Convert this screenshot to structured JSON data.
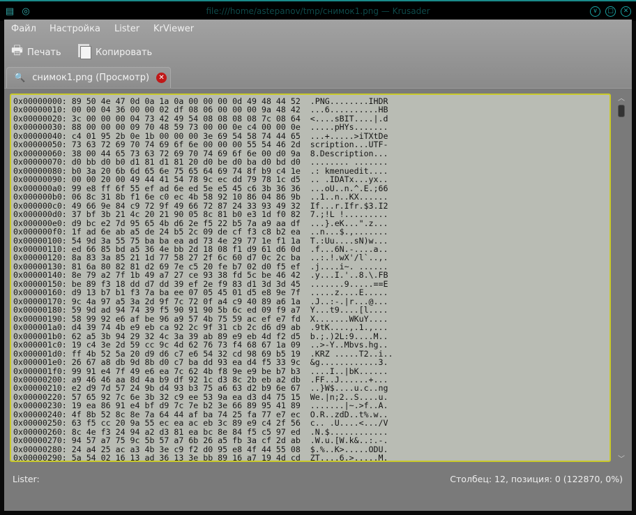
{
  "window": {
    "title": "file:///home/astepanov/tmp/снимок1.png — Krusader"
  },
  "menu": [
    "Файл",
    "Настройка",
    "Lister",
    "KrViewer"
  ],
  "toolbar": {
    "print": "Печать",
    "copy": "Копировать"
  },
  "tab": {
    "label": "снимок1.png (Просмотр)"
  },
  "status": {
    "left": "Lister:",
    "right": "Столбец:  12, позиция: 0 (122870, 0%)"
  },
  "colors": {
    "viewer_bg": "#b9bcb4",
    "viewer_border": "#c9c92a",
    "accent": "#1aa3a3"
  },
  "rows": [
    [
      "0x00000000:",
      "89 50 4e 47 0d 0a 1a 0a 00 00 00 0d 49 48 44 52",
      ".PNG........IHDR"
    ],
    [
      "0x00000010:",
      "00 00 04 36 00 00 02 df 08 06 00 00 00 9a 48 42",
      "...6..........HB"
    ],
    [
      "0x00000020:",
      "3c 00 00 00 04 73 42 49 54 08 08 08 08 7c 08 64",
      "<....sBIT....|.d"
    ],
    [
      "0x00000030:",
      "88 00 00 00 09 70 48 59 73 00 00 0e c4 00 00 0e",
      ".....pHYs......."
    ],
    [
      "0x00000040:",
      "c4 01 95 2b 0e 1b 00 00 00 3e 69 54 58 74 44 65",
      "...+.....>iTXtDe"
    ],
    [
      "0x00000050:",
      "73 63 72 69 70 74 69 6f 6e 00 00 00 55 54 46 2d",
      "scription...UTF-"
    ],
    [
      "0x00000060:",
      "38 00 44 65 73 63 72 69 70 74 69 6f 6e 00 d0 9a",
      "8.Description..."
    ],
    [
      "0x00000070:",
      "d0 bb d0 b0 d1 81 d1 81 20 d0 be d0 ba d0 bd d0",
      "........ ......."
    ],
    [
      "0x00000080:",
      "b0 3a 20 6b 6d 65 6e 75 65 64 69 74 8f b9 c4 1e",
      ".: kmenuedit...."
    ],
    [
      "0x00000090:",
      "00 00 20 00 49 44 41 54 78 9c ec dd 79 78 1c d5",
      ".. .IDATx...yx.."
    ],
    [
      "0x000000a0:",
      "99 e8 ff 6f 55 ef ad 6e ed 5e e5 45 c6 3b 36 36",
      "...oU..n.^.E.;66"
    ],
    [
      "0x000000b0:",
      "06 8c 31 8b f1 6e c0 ec 4b 58 92 10 86 04 86 9b",
      "..1..n..KX......"
    ],
    [
      "0x000000c0:",
      "49 66 9e 84 c9 72 9f 49 66 72 87 24 33 93 49 32",
      "If...r.Ifr.$3.I2"
    ],
    [
      "0x000000d0:",
      "37 bf 3b 21 4c 20 21 90 05 8c 81 b0 e3 1d f0 82",
      "7.;!L !........."
    ],
    [
      "0x000000e0:",
      "d9 bc e2 7d 95 65 4b d6 2e f5 22 b5 7a a9 aa df",
      "...}.eK...\".z..."
    ],
    [
      "0x000000f0:",
      "1f ad 6e ab a5 de 24 b5 2c 09 de cf f3 c8 b2 ea",
      "..n...$.,......."
    ],
    [
      "0x00000100:",
      "54 9d 3a 55 75 ba ba ea ad 73 4e 29 77 1e f1 1a",
      "T.:Uu....sN)w..."
    ],
    [
      "0x00000110:",
      "ed 66 85 bd a5 36 4e bb 2d 18 08 f1 d9 61 d6 0d",
      ".f...6N.-....a.."
    ],
    [
      "0x00000120:",
      "8a 83 3a 85 21 1d 77 58 27 2f 6c 60 d7 0c 2c ba",
      "..:.!.wX'/l`..,."
    ],
    [
      "0x00000130:",
      "81 6a 80 82 81 d2 69 7e c5 20 fe b7 02 d0 f5 ef",
      ".j....i~. ......"
    ],
    [
      "0x00000140:",
      "8e 79 a2 7f 1b 49 a7 27 ce 93 38 fd 5c be 46 42",
      ".y...I.'..8.\\.FB"
    ],
    [
      "0x00000150:",
      "be 89 f3 18 dd d7 dd 39 ef 2e f9 83 d1 3d 3d 45",
      ".......9.....==E"
    ],
    [
      "0x00000160:",
      "d9 13 b7 b1 f3 7a ba ee 07 05 45 01 d5 e8 9e 7f",
      ".....z....E....."
    ],
    [
      "0x00000170:",
      "9c 4a 97 a5 3a 2d 9f 7c 72 0f a4 c9 40 89 a6 1a",
      ".J..:-.|r...@..."
    ],
    [
      "0x00000180:",
      "59 9d ad 94 74 39 f5 90 91 90 5b 6c ed 09 f9 a7",
      "Y...t9....[l...."
    ],
    [
      "0x00000190:",
      "58 99 92 e6 af be 96 a9 57 4b 75 59 ac ef e7 fd",
      "X.......WKuY...."
    ],
    [
      "0x000001a0:",
      "d4 39 74 4b e9 eb ca 92 2c 9f 31 cb 2c d6 d9 ab",
      ".9tK....,.1.,..."
    ],
    [
      "0x000001b0:",
      "62 a5 3b 94 29 32 4c 3a 39 ab 89 e9 eb 4d f2 d5",
      "b.;.)2L:9....M.."
    ],
    [
      "0x000001c0:",
      "19 c4 3e 2d 59 cc 9c 4d 62 76 73 f4 68 67 1a 09",
      "..>-Y..Mbvs.hg.."
    ],
    [
      "0x000001d0:",
      "ff 4b 52 5a 20 d9 d6 c7 e6 54 32 cd 98 69 b5 19",
      ".KRZ .....T2..i.."
    ],
    [
      "0x000001e0:",
      "26 67 a8 db 9d 8b d0 c7 ba dd 93 ea d4 f5 33 9c",
      "&g............3."
    ],
    [
      "0x000001f0:",
      "99 91 e4 7f 49 e6 ea 7c 62 4b f8 9e e9 be b7 b3",
      "....I..|bK......"
    ],
    [
      "0x00000200:",
      "a9 46 46 aa 8d 4a b9 df 92 1c d3 8c 2b eb a2 db",
      ".FF..J......+..."
    ],
    [
      "0x00000210:",
      "e2 d9 7d 57 24 9b d4 93 b3 75 a6 63 d2 b9 6e 67",
      "..}W$....u.c..ng"
    ],
    [
      "0x00000220:",
      "57 65 92 7c 6e 3b 32 c9 ee 53 9a ea d3 d4 75 15",
      "We.|n;2..S....u."
    ],
    [
      "0x00000230:",
      "19 ea 86 91 e4 bf d9 7c 7e b2 3e 66 89 95 41 89",
      ".......|~.>f..A."
    ],
    [
      "0x00000240:",
      "4f 8b 52 8c 8e 7a 64 44 af ba 74 25 fa 77 e7 ec",
      "O.R..zdD..t%.w.."
    ],
    [
      "0x00000250:",
      "63 f5 cc 20 9a 55 ec ea ac eb 3c 89 e9 c4 2f 56",
      "c.. .U....<.../V"
    ],
    [
      "0x00000260:",
      "8c 4e f3 24 94 a2 d3 81 ea bc 8e 84 f5 c5 97 ed",
      ".N.$............"
    ],
    [
      "0x00000270:",
      "94 57 a7 75 9c 5b 57 a7 6b 26 a5 fb 3a cf 2d ab",
      ".W.u.[W.k&..:.-."
    ],
    [
      "0x00000280:",
      "24 a4 25 ac a3 4b 3e c9 f2 d0 95 e8 4f 44 55 08",
      "$.%..K>.....ODU."
    ],
    [
      "0x00000290:",
      "5a 54 02 16 13 ad 36 13 3e bb 89 16 a7 19 4d cd",
      "ZT....6.>.....M."
    ]
  ]
}
